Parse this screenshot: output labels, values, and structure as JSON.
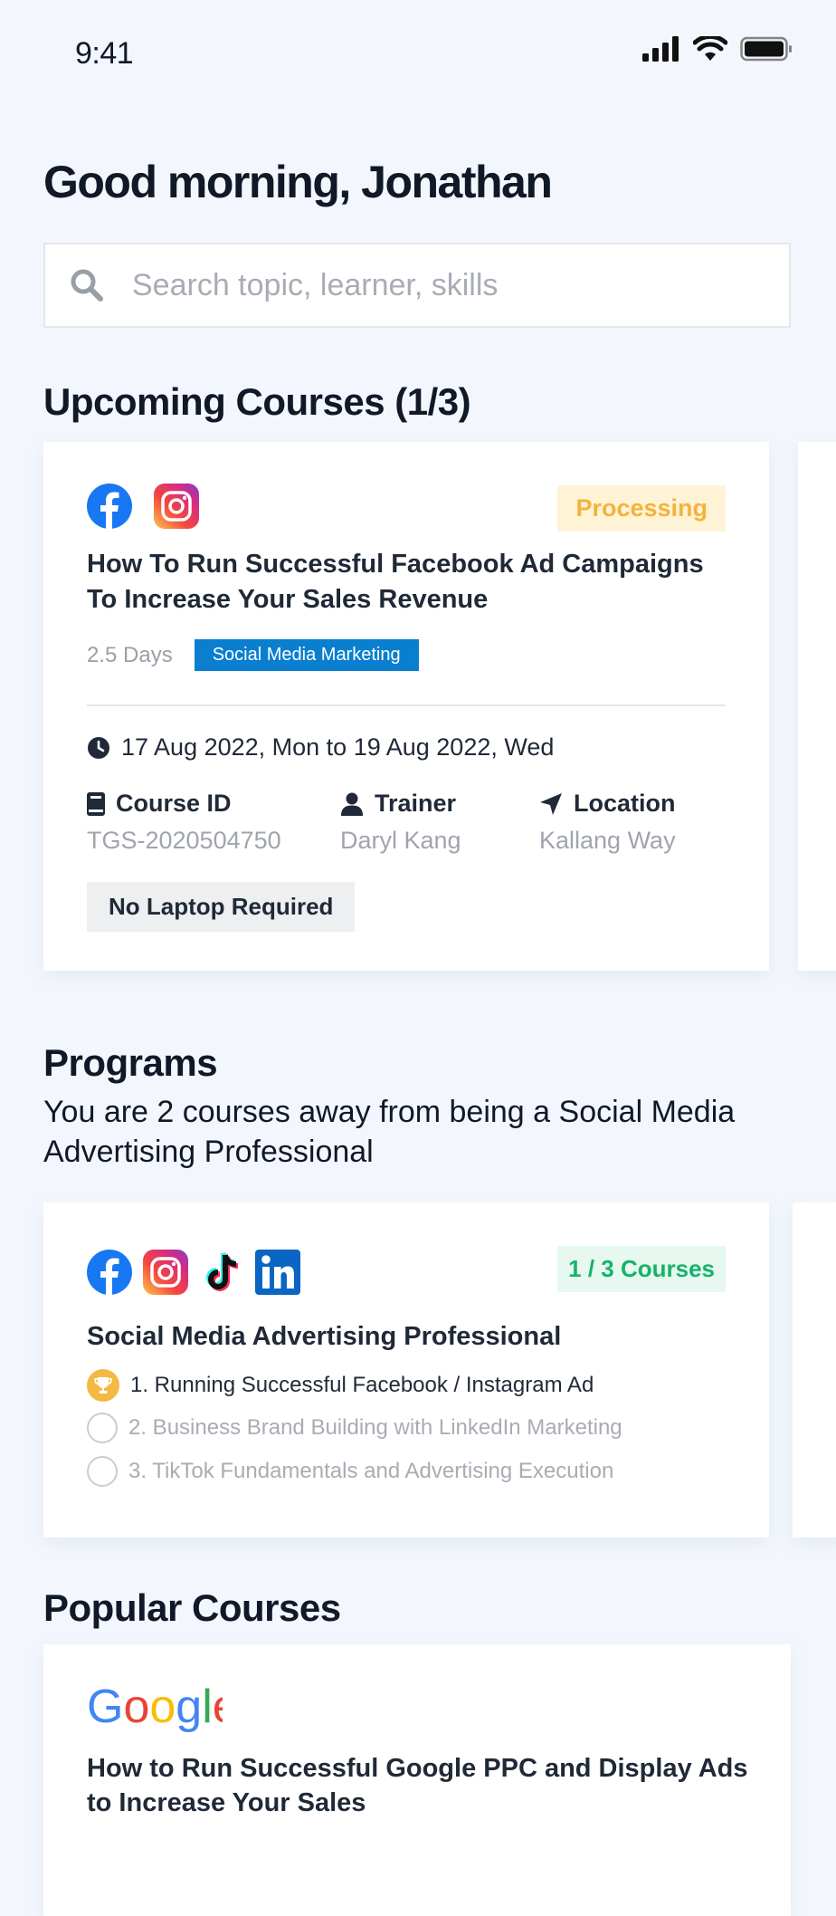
{
  "status_bar": {
    "time": "9:41"
  },
  "greeting": "Good morning, Jonathan",
  "search": {
    "placeholder": "Search topic, learner, skills"
  },
  "upcoming": {
    "title": "Upcoming Courses (1/3)",
    "course": {
      "status": "Processing",
      "title": "How To Run Successful Facebook Ad Campaigns To Increase Your Sales Revenue",
      "duration": "2.5 Days",
      "tag": "Social Media Marketing",
      "date_range": "17 Aug 2022, Mon to 19 Aug 2022, Wed",
      "course_id_label": "Course ID",
      "course_id": "TGS-2020504750",
      "trainer_label": "Trainer",
      "trainer": "Daryl Kang",
      "location_label": "Location",
      "location": "Kallang Way",
      "requirement": "No Laptop Required"
    }
  },
  "programs": {
    "title": "Programs",
    "subtitle": "You are 2 courses away from  being a Social Media Advertising Professional",
    "card": {
      "progress": "1 / 3  Courses",
      "title": "Social Media Advertising Professional",
      "items": [
        {
          "label": "1. Running Successful Facebook / Instagram Ad",
          "done": true
        },
        {
          "label": "2. Business Brand Building with LinkedIn Marketing",
          "done": false
        },
        {
          "label": "3. TikTok Fundamentals and Advertising Execution",
          "done": false
        }
      ]
    }
  },
  "popular": {
    "title": "Popular Courses",
    "course": {
      "title": "How to Run Successful Google PPC and Display Ads to Increase Your Sales"
    }
  },
  "colors": {
    "background": "#f3f7fd",
    "processing_bg": "#fff3d6",
    "processing_text": "#f3b33d",
    "tag_blue": "#0a7fd0",
    "courses_badge_bg": "#e6f8ef",
    "courses_badge_text": "#17b26a",
    "trophy": "#f4b942"
  },
  "icons": [
    "signal-icon",
    "wifi-icon",
    "battery-icon",
    "search-icon",
    "facebook-logo",
    "instagram-logo",
    "tiktok-logo",
    "linkedin-logo",
    "google-logo",
    "clock-icon",
    "book-icon",
    "user-icon",
    "location-arrow-icon",
    "trophy-icon"
  ]
}
